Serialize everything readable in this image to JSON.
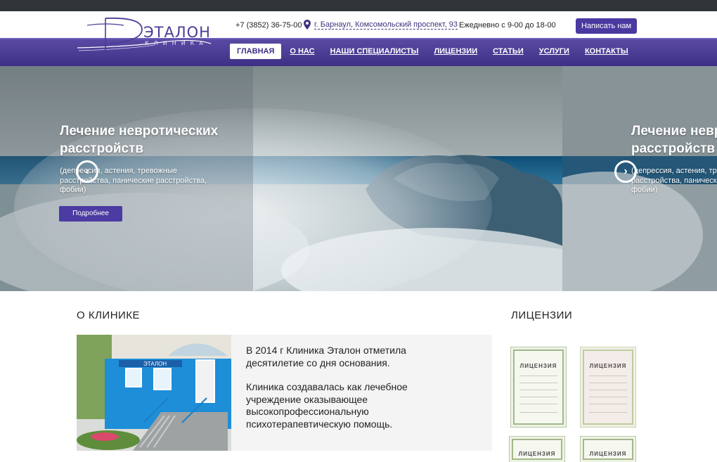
{
  "header": {
    "logo": {
      "word": "ЭТАЛОН",
      "sub": "КЛИНИКА"
    },
    "phone": "+7 (3852) 36-75-00",
    "address": "г. Барнаул, Комсомольский проспект, 93",
    "hours": "Ежедневно с 9-00 до 18-00",
    "write_button": "Написать нам"
  },
  "nav": [
    {
      "label": "ГЛАВНАЯ",
      "active": true
    },
    {
      "label": "О НАС"
    },
    {
      "label": "НАШИ СПЕЦИАЛИСТЫ"
    },
    {
      "label": "ЛИЦЕНЗИИ"
    },
    {
      "label": "СТАТЬИ"
    },
    {
      "label": "УСЛУГИ"
    },
    {
      "label": "КОНТАКТЫ"
    }
  ],
  "slides": [
    {
      "title": "Лечение невротических расстройств",
      "description": "(депрессия, астения, тревожные расстройства, панические расстройства, фобии)",
      "button": "Подробнее"
    },
    {
      "title": "Лечение невротических расстройств",
      "description": "(депрессия, астения, тревожные расстройства, панические расстройства, фобии)"
    }
  ],
  "about": {
    "heading": "О КЛИНИКЕ",
    "paragraphs": [
      "В 2014 г Клиника Эталон отметила десятилетие со дня основания.",
      "Клиника создавалась как лечебное учреждение оказывающее высокопрофессиональную психотерапевтическую помощь."
    ],
    "sign_text": "ЭТАЛОН"
  },
  "licenses": {
    "heading": "ЛИЦЕНЗИИ",
    "doc_title": "ЛИЦЕНЗИЯ"
  },
  "colors": {
    "brand": "#4a3aa0",
    "nav_bg": "#3e2f86",
    "topstrip": "#2f3438"
  },
  "icons": {
    "prev": "chevron-left-icon",
    "next": "chevron-right-icon",
    "location": "map-pin-icon"
  }
}
